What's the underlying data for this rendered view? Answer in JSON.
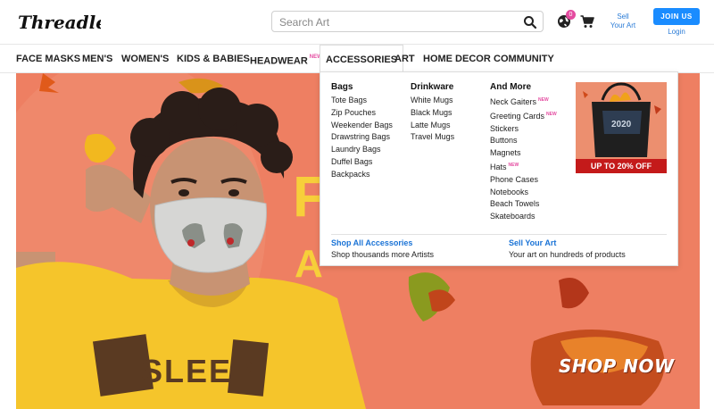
{
  "header": {
    "logo_text": "Threadless",
    "search_placeholder": "Search Art",
    "cart_badge": "0",
    "sell_label_line1": "Sell",
    "sell_label_line2": "Your Art",
    "join_label": "JOIN US",
    "login_label": "Login"
  },
  "nav": [
    {
      "label": "FACE MASKS"
    },
    {
      "label": "MEN'S"
    },
    {
      "label": "WOMEN'S"
    },
    {
      "label": "KIDS & BABIES"
    },
    {
      "label": "HEADWEAR",
      "badge": "NEW"
    },
    {
      "label": "ACCESSORIES"
    },
    {
      "label": "ART"
    },
    {
      "label": "HOME DECOR"
    },
    {
      "label": "COMMUNITY"
    }
  ],
  "dropdown": {
    "columns": [
      {
        "title": "Bags",
        "items": [
          {
            "label": "Tote Bags"
          },
          {
            "label": "Zip Pouches"
          },
          {
            "label": "Weekender Bags"
          },
          {
            "label": "Drawstring Bags"
          },
          {
            "label": "Laundry Bags"
          },
          {
            "label": "Duffel Bags"
          },
          {
            "label": "Backpacks"
          }
        ]
      },
      {
        "title": "Drinkware",
        "items": [
          {
            "label": "White Mugs"
          },
          {
            "label": "Black Mugs"
          },
          {
            "label": "Latte Mugs"
          },
          {
            "label": "Travel Mugs"
          }
        ]
      },
      {
        "title": "And More",
        "items": [
          {
            "label": "Neck Gaiters",
            "badge": "NEW"
          },
          {
            "label": "Greeting Cards",
            "badge": "NEW"
          },
          {
            "label": "Stickers"
          },
          {
            "label": "Buttons"
          },
          {
            "label": "Magnets"
          },
          {
            "label": "Hats",
            "badge": "NEW"
          },
          {
            "label": "Phone Cases"
          },
          {
            "label": "Notebooks"
          },
          {
            "label": "Beach Towels"
          },
          {
            "label": "Skateboards"
          }
        ]
      }
    ],
    "promo": {
      "label": "UP TO 20% OFF",
      "tote_text": "2020"
    },
    "footer": {
      "shop_all": "Shop All Accessories",
      "shop_all_sub": "Shop thousands more Artists",
      "sell": "Sell Your Art",
      "sell_sub": "Your art on hundreds of products"
    }
  },
  "hero": {
    "cta": "SHOP NOW",
    "partial_text_top": "F",
    "partial_text_bottom": "A",
    "shirt_text": "SLEEP"
  },
  "colors": {
    "accent_blue": "#1a8cff",
    "link_blue": "#1a73d6",
    "new_pink": "#e44ba0",
    "hero_bg": "#ee7f62",
    "shirt_yellow": "#f5c52b",
    "promo_red": "#c41a1a"
  }
}
